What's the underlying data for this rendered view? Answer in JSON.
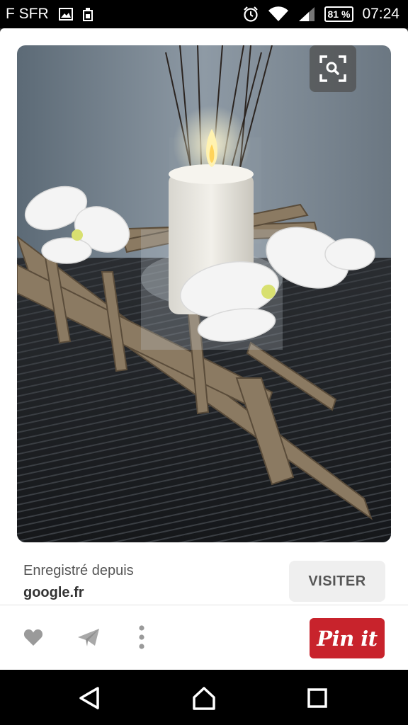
{
  "status_bar": {
    "carrier": "F SFR",
    "battery": "81 %",
    "time": "07:24",
    "icons": [
      "image-icon",
      "sim-icon",
      "alarm-icon",
      "wifi-icon",
      "signal-icon",
      "battery-icon"
    ]
  },
  "pin": {
    "image_alt": "",
    "lens_icon": "visual-search-icon"
  },
  "source": {
    "saved_from_label": "Enregistré depuis",
    "domain": "google.fr"
  },
  "buttons": {
    "visit_label": "VISITER",
    "pinit_label": "Pin it"
  },
  "actions": {
    "icons": [
      "heart-icon",
      "send-icon",
      "more-vertical-icon"
    ]
  },
  "colors": {
    "pinit_red": "#c8232c",
    "visit_bg": "#efefef"
  },
  "nav_bar": {
    "icons": [
      "back-icon",
      "home-icon",
      "recents-icon"
    ]
  }
}
